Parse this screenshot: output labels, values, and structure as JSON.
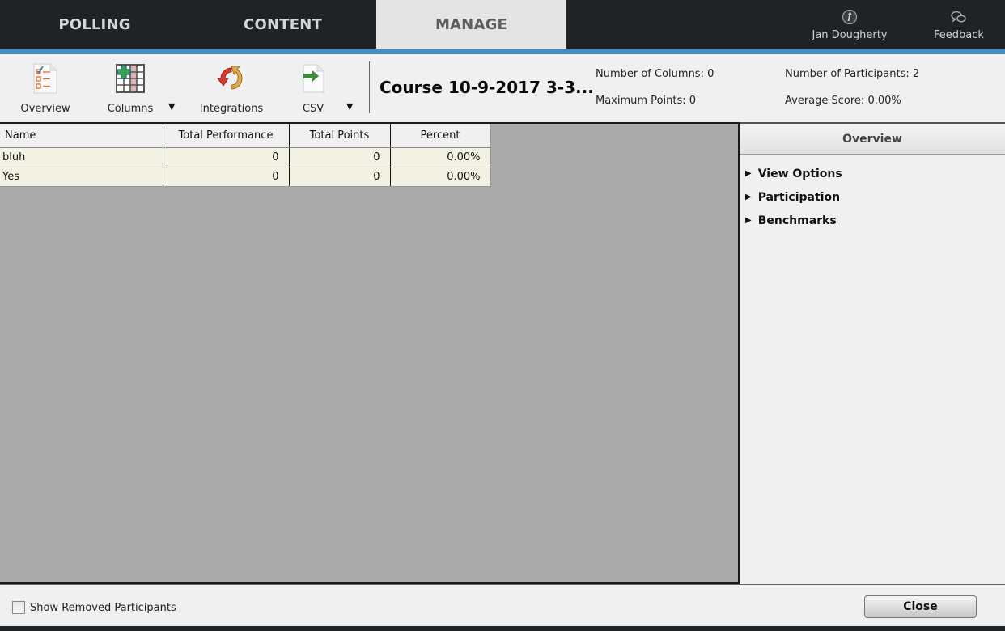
{
  "nav": {
    "tabs": [
      {
        "label": "POLLING",
        "active": false
      },
      {
        "label": "CONTENT",
        "active": false
      },
      {
        "label": "MANAGE",
        "active": true
      }
    ],
    "user": {
      "name": "Jan Dougherty",
      "icon": "user-info-icon"
    },
    "feedback": {
      "label": "Feedback",
      "icon": "speech-bubbles-icon"
    }
  },
  "toolbar": {
    "overview_label": "Overview",
    "columns_label": "Columns",
    "integrations_label": "Integrations",
    "csv_label": "CSV",
    "dropdown_arrow": "▼",
    "course_title": "Course 10-9-2017 3-3...",
    "stats": {
      "columns": "Number of Columns: 0",
      "max_points": "Maximum Points: 0",
      "participants": "Number of Participants: 2",
      "average_score": "Average Score: 0.00%"
    }
  },
  "grid": {
    "headers": [
      "Name",
      "Total Performance",
      "Total Points",
      "Percent"
    ],
    "rows": [
      [
        "bluh",
        "0",
        "0",
        "0.00%"
      ],
      [
        "Yes",
        "0",
        "0",
        "0.00%"
      ]
    ]
  },
  "side": {
    "title": "Overview",
    "items": [
      {
        "label": "View Options",
        "expanded": false
      },
      {
        "label": "Participation",
        "expanded": false
      },
      {
        "label": "Benchmarks",
        "expanded": false
      }
    ],
    "collapsed_glyph": "▶"
  },
  "footer": {
    "show_removed_label": "Show Removed Participants",
    "show_removed_checked": false,
    "close_label": "Close"
  },
  "colors": {
    "accent_blue": "#3b8fcb",
    "nav_bg": "#202326",
    "row_bg": "#f3f1e1",
    "grid_bg": "#aaaaaa"
  }
}
